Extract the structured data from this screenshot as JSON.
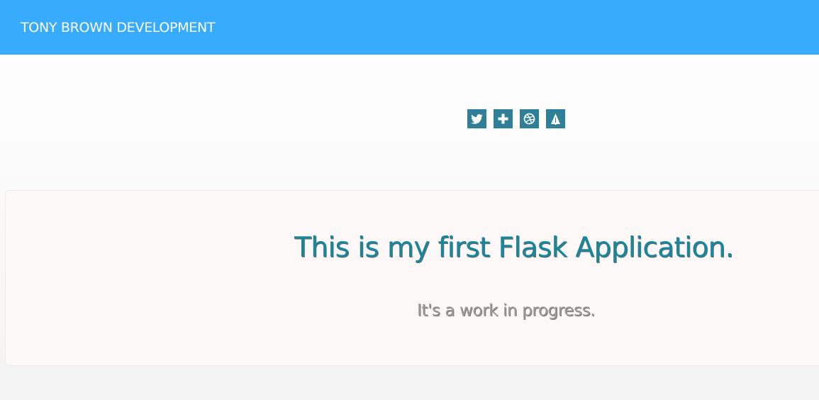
{
  "navbar": {
    "brand": "TONY BROWN DEVELOPMENT",
    "background": "#38acfc"
  },
  "social": {
    "color": "#2f7f98",
    "links": [
      {
        "icon": "twitter-icon"
      },
      {
        "icon": "google-plus-icon"
      },
      {
        "icon": "dribbble-icon"
      },
      {
        "icon": "forrst-icon"
      }
    ]
  },
  "jumbotron": {
    "title": "This is my first Flask Application.",
    "subtitle": "It's a work in progress.",
    "title_color": "#16879c",
    "subtitle_color": "#9b9b9b"
  }
}
